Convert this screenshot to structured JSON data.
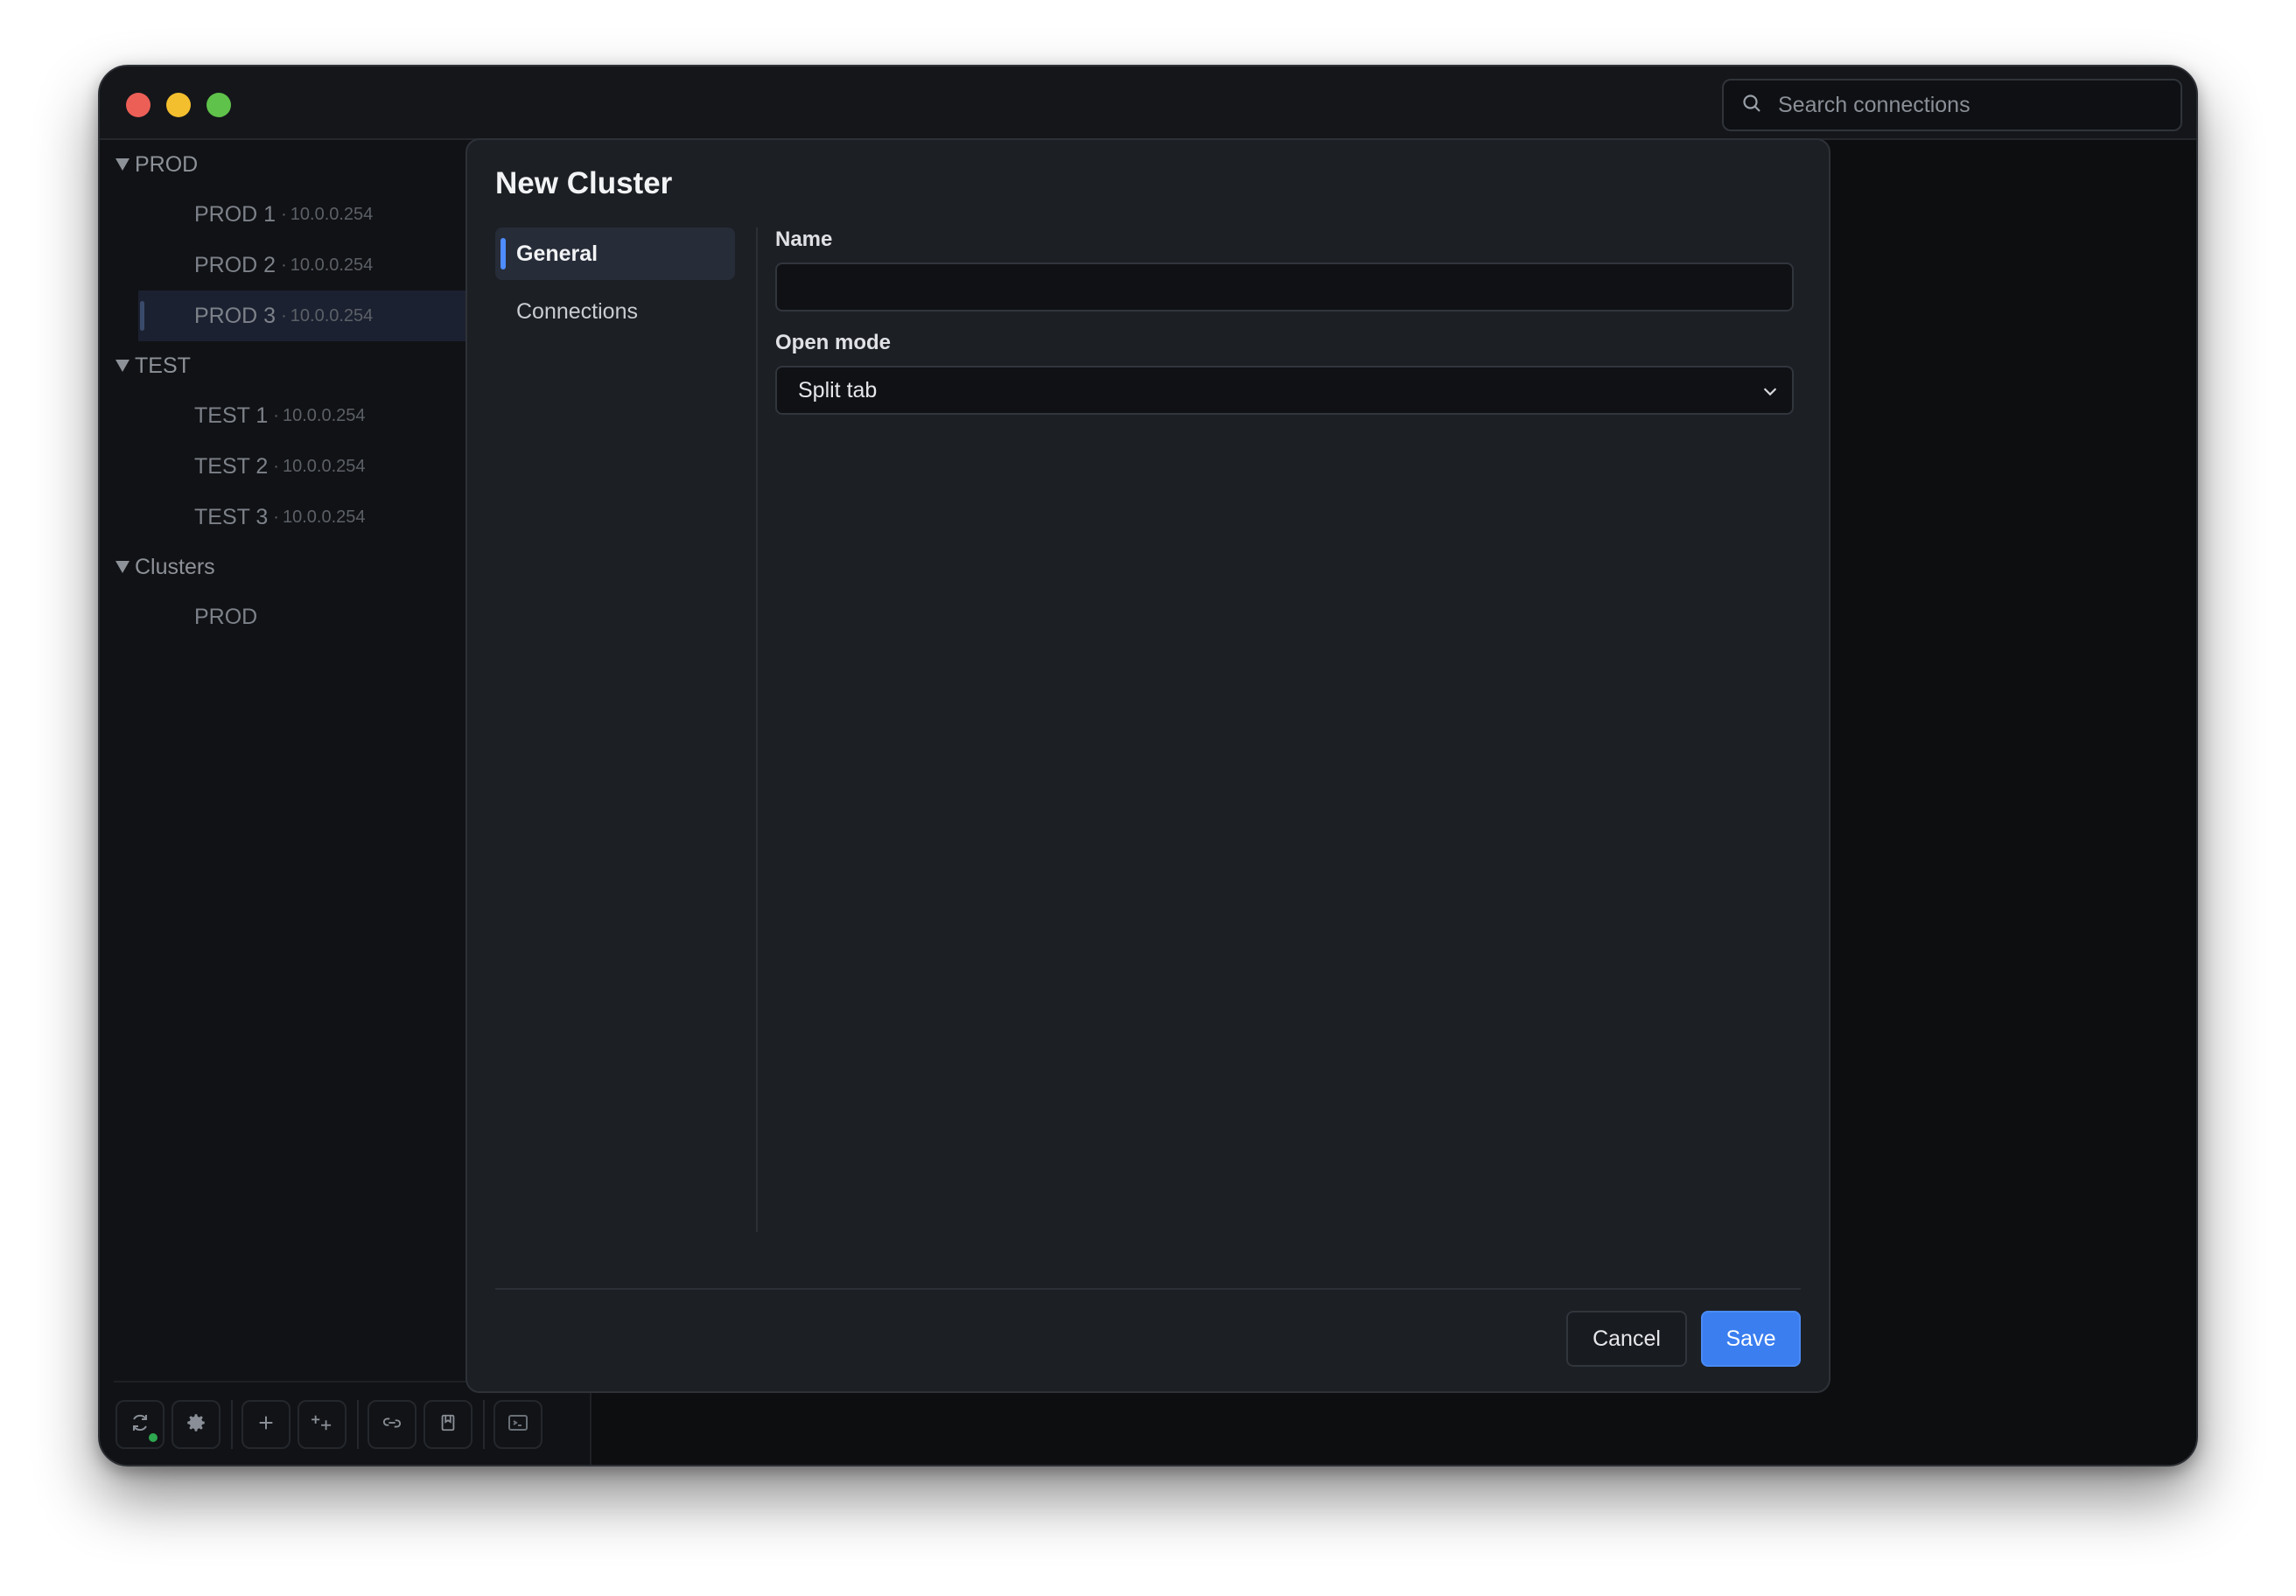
{
  "window": {
    "search_placeholder": "Search connections"
  },
  "sidebar": {
    "groups": [
      {
        "label": "PROD",
        "items": [
          {
            "name": "PROD 1",
            "ip": "10.0.0.254"
          },
          {
            "name": "PROD 2",
            "ip": "10.0.0.254"
          },
          {
            "name": "PROD 3",
            "ip": "10.0.0.254",
            "selected": true
          }
        ]
      },
      {
        "label": "TEST",
        "items": [
          {
            "name": "TEST 1",
            "ip": "10.0.0.254"
          },
          {
            "name": "TEST 2",
            "ip": "10.0.0.254"
          },
          {
            "name": "TEST 3",
            "ip": "10.0.0.254"
          }
        ]
      },
      {
        "label": "Clusters",
        "items": [
          {
            "name": "PROD"
          }
        ]
      }
    ],
    "ip_separator": "·"
  },
  "toolbar": {
    "icons": [
      "sync-icon",
      "gear-icon",
      "plus-icon",
      "add-cluster-icon",
      "link-icon",
      "bookmark-icon",
      "terminal-icon"
    ],
    "sync_status_color": "#2fa84f"
  },
  "modal": {
    "title": "New Cluster",
    "nav": [
      {
        "label": "General",
        "active": true
      },
      {
        "label": "Connections",
        "active": false
      }
    ],
    "name_label": "Name",
    "name_value": "",
    "open_mode_label": "Open mode",
    "open_mode_value": "Split tab",
    "cancel_label": "Cancel",
    "save_label": "Save"
  },
  "colors": {
    "accent": "#3a7ef0",
    "window_bg": "#111316",
    "modal_bg": "#1c1f24"
  }
}
